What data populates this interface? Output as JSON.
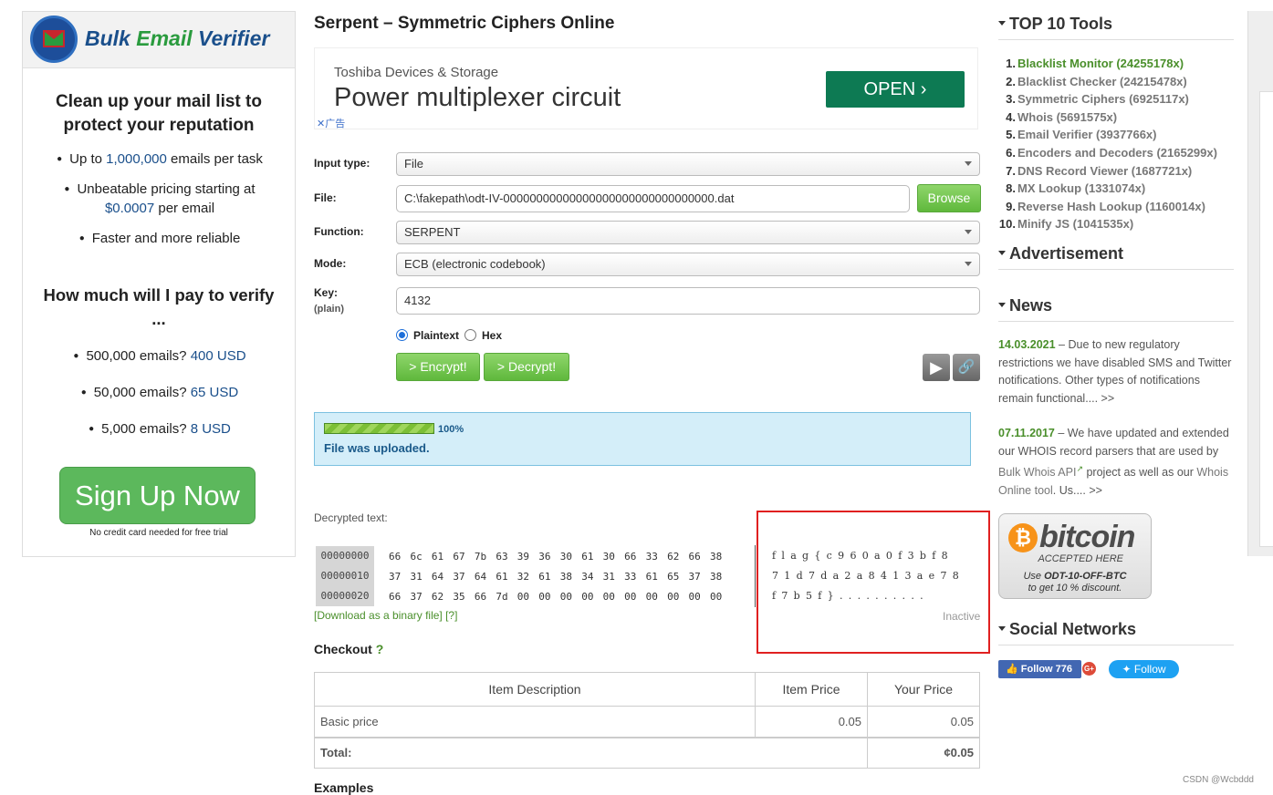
{
  "left_ad": {
    "brand": [
      "Bulk ",
      "Email",
      " Verifier"
    ],
    "headline": "Clean up your mail list to protect your reputation",
    "bullet1": [
      "Up to ",
      "1,000,000",
      " emails per task"
    ],
    "bullet2": [
      "Unbeatable pricing starting at",
      "$0.0007",
      " per email"
    ],
    "bullet3": "Faster and more reliable",
    "question": "How much will I pay to verify ...",
    "price1": [
      "500,000 emails? ",
      "400 USD"
    ],
    "price2": [
      "50,000 emails? ",
      "65 USD"
    ],
    "price3": [
      "5,000 emails? ",
      "8 USD"
    ],
    "cta": "Sign Up Now",
    "fine": "No credit card needed for free trial"
  },
  "page_title": "Serpent – Symmetric Ciphers Online",
  "google_ad": {
    "sponsor": "Toshiba Devices & Storage",
    "title": "Power multiplexer circuit",
    "cta": "OPEN",
    "close": "✕广告"
  },
  "form": {
    "input_type_label": "Input type:",
    "input_type_value": "File",
    "file_label": "File:",
    "file_value": "C:\\fakepath\\odt-IV-00000000000000000000000000000000.dat",
    "browse": "Browse",
    "function_label": "Function:",
    "function_value": "SERPENT",
    "mode_label": "Mode:",
    "mode_value": "ECB (electronic codebook)",
    "key_label": "Key:",
    "key_sub": "(plain)",
    "key_value": "4132",
    "radio_plaintext": "Plaintext",
    "radio_hex": "Hex",
    "encrypt": "> Encrypt!",
    "decrypt": "> Decrypt!"
  },
  "upload": {
    "progress": 1.0,
    "percent_text": "100%",
    "message": "File was uploaded."
  },
  "decrypted": {
    "label": "Decrypted text:",
    "rows": [
      {
        "offset": "00000000",
        "hex": "66 6c 61 67 7b 63 39 36 30 61 30 66 33 62 66 38",
        "ascii": "flag{c960a0f3bf8"
      },
      {
        "offset": "00000010",
        "hex": "37 31 64 37 64 61 32 61 38 34 31 33 61 65 37 38",
        "ascii": "71d7da2a8413ae78"
      },
      {
        "offset": "00000020",
        "hex": "66 37 62 35 66 7d 00 00 00 00 00 00 00 00 00 00",
        "ascii": "f7b5f}.........."
      }
    ],
    "download": "[Download as a binary file]",
    "help": "[?]",
    "status": "Inactive"
  },
  "checkout": {
    "title": "Checkout",
    "q": "?",
    "headers": [
      "Item Description",
      "Item Price",
      "Your Price"
    ],
    "row": [
      "Basic price",
      "0.05",
      "0.05"
    ],
    "total_label": "Total:",
    "total_value": "¢0.05"
  },
  "examples_title": "Examples",
  "sidebar": {
    "top10_title": "TOP 10 Tools",
    "tools": [
      {
        "n": "1.",
        "name": "Blacklist Monitor (24255178x)"
      },
      {
        "n": "2.",
        "name": "Blacklist Checker (24215478x)"
      },
      {
        "n": "3.",
        "name": "Symmetric Ciphers (6925117x)"
      },
      {
        "n": "4.",
        "name": "Whois (5691575x)"
      },
      {
        "n": "5.",
        "name": "Email Verifier (3937766x)"
      },
      {
        "n": "6.",
        "name": "Encoders and Decoders (2165299x)"
      },
      {
        "n": "7.",
        "name": "DNS Record Viewer (1687721x)"
      },
      {
        "n": "8.",
        "name": "MX Lookup (1331074x)"
      },
      {
        "n": "9.",
        "name": "Reverse Hash Lookup (1160014x)"
      },
      {
        "n": "10.",
        "name": "Minify JS (1041535x)"
      }
    ],
    "ad_title": "Advertisement",
    "news_title": "News",
    "news1_date": "14.03.2021",
    "news1_text": " – Due to new regulatory restrictions we have disabled SMS and Twitter notifications. Other types of notifications remain functional.... >>",
    "news2_date": "07.11.2017",
    "news2_a": " – We have updated and extended our WHOIS record parsers that are used by ",
    "news2_link1": "Bulk Whois API",
    "news2_b": " project as well as our ",
    "news2_link2": "Whois Online tool",
    "news2_c": ". Us.... >>",
    "btc_word": "bitcoin",
    "btc_accepted": "ACCEPTED HERE",
    "btc_use": "Use ",
    "btc_code": "ODT-10-OFF-BTC",
    "btc_tail": "to get 10 % discount.",
    "social_title": "Social Networks",
    "fb": "Follow 776",
    "gplus": "G+",
    "twitter": "Follow"
  },
  "watermark": "CSDN @Wcbddd",
  "colors": {
    "accent_green": "#5cb85c",
    "highlight_red": "#e02020",
    "link_green": "#4a8f2b"
  }
}
